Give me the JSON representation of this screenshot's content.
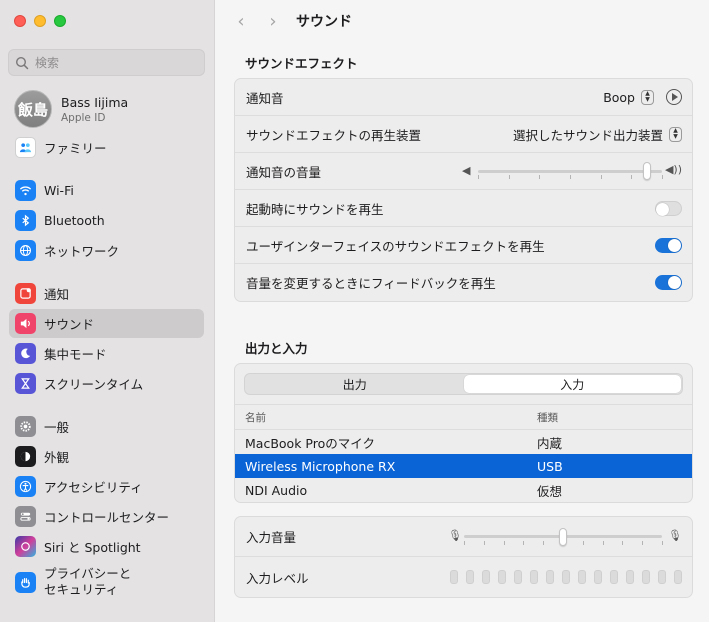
{
  "sidebar": {
    "search_placeholder": "検索",
    "profile": {
      "avatar_text": "飯島",
      "name": "Bass Iijima",
      "sub": "Apple ID"
    },
    "items": [
      {
        "label": "ファミリー",
        "icon": "family-icon",
        "color": "#ffffff"
      },
      {
        "label": "Wi-Fi",
        "icon": "wifi-icon",
        "color": "#1a82f5"
      },
      {
        "label": "Bluetooth",
        "icon": "bluetooth-icon",
        "color": "#1a82f5"
      },
      {
        "label": "ネットワーク",
        "icon": "globe-icon",
        "color": "#1a82f5"
      },
      {
        "label": "通知",
        "icon": "bell-icon",
        "color": "#f0453a"
      },
      {
        "label": "サウンド",
        "icon": "speaker-icon",
        "color": "#f0446a"
      },
      {
        "label": "集中モード",
        "icon": "moon-icon",
        "color": "#5856d6"
      },
      {
        "label": "スクリーンタイム",
        "icon": "hourglass-icon",
        "color": "#5856d6"
      },
      {
        "label": "一般",
        "icon": "gear-icon",
        "color": "#8e8e93"
      },
      {
        "label": "外観",
        "icon": "appearance-icon",
        "color": "#1c1c1e"
      },
      {
        "label": "アクセシビリティ",
        "icon": "accessibility-icon",
        "color": "#1a82f5"
      },
      {
        "label": "コントロールセンター",
        "icon": "control-center-icon",
        "color": "#8e8e93"
      },
      {
        "label": "Siri と Spotlight",
        "icon": "siri-icon",
        "color": "#7a3fd1"
      },
      {
        "label_line1": "プライバシーと",
        "label_line2": "セキュリティ",
        "icon": "hand-icon",
        "color": "#1a82f5"
      }
    ],
    "active_index": 5
  },
  "header": {
    "title": "サウンド"
  },
  "effects": {
    "title": "サウンドエフェクト",
    "alert_sound_label": "通知音",
    "alert_sound_value": "Boop",
    "output_device_label": "サウンドエフェクトの再生装置",
    "output_device_value": "選択したサウンド出力装置",
    "alert_volume_label": "通知音の音量",
    "alert_volume_level": 0.92,
    "startup_label": "起動時にサウンドを再生",
    "startup_on": false,
    "ui_effects_label": "ユーザインターフェイスのサウンドエフェクトを再生",
    "ui_effects_on": true,
    "feedback_label": "音量を変更するときにフィードバックを再生",
    "feedback_on": true
  },
  "io": {
    "title": "出力と入力",
    "tab_output": "出力",
    "tab_input": "入力",
    "selected_tab": "input",
    "col_name": "名前",
    "col_type": "種類",
    "devices": [
      {
        "name": "MacBook Proのマイク",
        "type": "内蔵"
      },
      {
        "name": "Wireless Microphone RX",
        "type": "USB"
      },
      {
        "name": "NDI Audio",
        "type": "仮想"
      }
    ],
    "selected_device_index": 1,
    "input_volume_label": "入力音量",
    "input_volume_level": 0.5,
    "input_level_label": "入力レベル",
    "input_level_bars": 15
  },
  "colors": {
    "accent": "#0a64d6",
    "toggle_on": "#1a73d9"
  }
}
